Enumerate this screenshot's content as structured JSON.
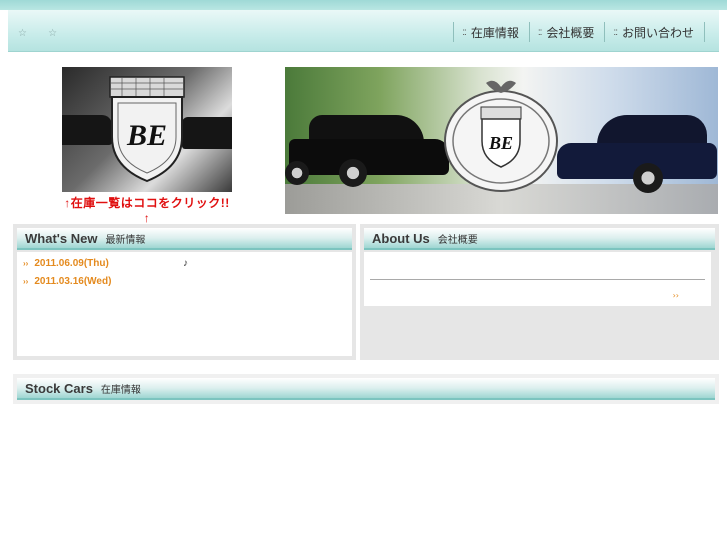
{
  "header": {
    "stars": [
      "☆",
      "☆"
    ],
    "nav": [
      {
        "icon": "::",
        "label": "在庫情報"
      },
      {
        "icon": "::",
        "label": "会社概要"
      },
      {
        "icon": "::",
        "label": "お問い合わせ"
      }
    ]
  },
  "logo": {
    "text": "BE",
    "caption": "↑在庫一覧はココをクリック!!↑"
  },
  "banner": {
    "badge_text": "BE"
  },
  "whats_new": {
    "title": "What's New",
    "subtitle": "最新情報",
    "items": [
      {
        "arrow": "››",
        "date": "2011.06.09(Thu)",
        "note": "♪"
      },
      {
        "arrow": "››",
        "date": "2011.03.16(Wed)",
        "note": ""
      }
    ]
  },
  "about": {
    "title": "About Us",
    "subtitle": "会社概要",
    "more": "››"
  },
  "stock": {
    "title": "Stock Cars",
    "subtitle": "在庫情報"
  },
  "colors": {
    "accent": "#7cc4bf",
    "date_orange": "#e48a1e",
    "caption_red": "#e01010"
  }
}
